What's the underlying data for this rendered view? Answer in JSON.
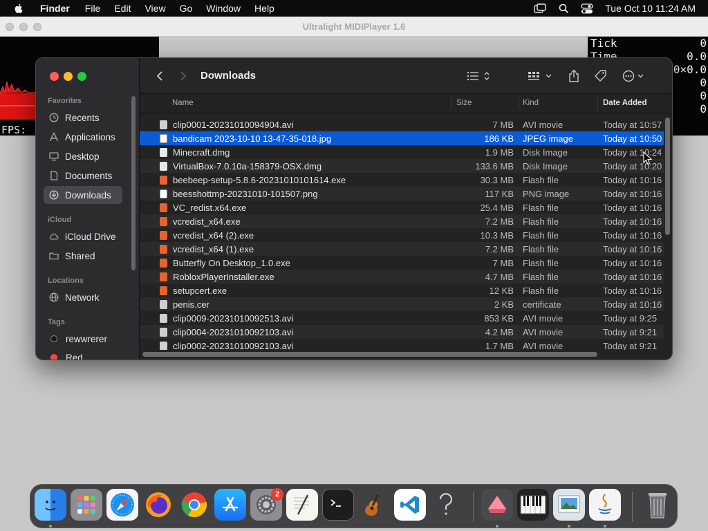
{
  "menubar": {
    "app_name": "Finder",
    "items": [
      "File",
      "Edit",
      "View",
      "Go",
      "Window",
      "Help"
    ],
    "clock": "Tue Oct 10  11:24 AM"
  },
  "background_app": {
    "title": "Ultralight MIDIPlayer 1.6",
    "fps_label": "FPS:",
    "stats": [
      {
        "label": "Tick",
        "value": "0"
      },
      {
        "label": "Time",
        "value": "0.0"
      },
      {
        "label": "",
        "value": "0×0.0"
      },
      {
        "label": "",
        "value": "0"
      },
      {
        "label": "",
        "value": "0"
      },
      {
        "label": "",
        "value": "0"
      }
    ]
  },
  "finder": {
    "folder_title": "Downloads",
    "sidebar": {
      "favorites_label": "Favorites",
      "favorites": [
        {
          "label": "Recents",
          "icon": "clock-icon"
        },
        {
          "label": "Applications",
          "icon": "applications-icon"
        },
        {
          "label": "Desktop",
          "icon": "desktop-icon"
        },
        {
          "label": "Documents",
          "icon": "document-icon"
        },
        {
          "label": "Downloads",
          "icon": "download-icon",
          "selected": true
        }
      ],
      "icloud_label": "iCloud",
      "icloud": [
        {
          "label": "iCloud Drive",
          "icon": "cloud-icon"
        },
        {
          "label": "Shared",
          "icon": "shared-folder-icon"
        }
      ],
      "locations_label": "Locations",
      "locations": [
        {
          "label": "Network",
          "icon": "globe-icon"
        }
      ],
      "tags_label": "Tags",
      "tags": [
        {
          "label": "rewwrerer",
          "color": "#1a1a1a"
        },
        {
          "label": "Red",
          "color": "#ff453a"
        }
      ]
    },
    "columns": {
      "name": "Name",
      "size": "Size",
      "kind": "Kind",
      "date": "Date Added"
    },
    "files": [
      {
        "name": "clip0001-20231010094904.avi",
        "size": "7 MB",
        "kind": "AVI movie",
        "date": "Today at 10:57",
        "icon": "movie"
      },
      {
        "name": "bandicam 2023-10-10 13-47-35-018.jpg",
        "size": "186 KB",
        "kind": "JPEG image",
        "date": "Today at 10:50",
        "icon": "img",
        "selected": true
      },
      {
        "name": "Minecraft.dmg",
        "size": "1.9 MB",
        "kind": "Disk Image",
        "date": "Today at 10:24",
        "icon": "doc"
      },
      {
        "name": "VirtualBox-7.0.10a-158379-OSX.dmg",
        "size": "133.6 MB",
        "kind": "Disk Image",
        "date": "Today at 10:20",
        "icon": "doc"
      },
      {
        "name": "beebeep-setup-5.8.6-20231010101614.exe",
        "size": "30.3 MB",
        "kind": "Flash file",
        "date": "Today at 10:16",
        "icon": "flash"
      },
      {
        "name": "beesshottmp-20231010-101507.png",
        "size": "117 KB",
        "kind": "PNG image",
        "date": "Today at 10:16",
        "icon": "img"
      },
      {
        "name": "VC_redist.x64.exe",
        "size": "25.4 MB",
        "kind": "Flash file",
        "date": "Today at 10:16",
        "icon": "flash"
      },
      {
        "name": "vcredist_x64.exe",
        "size": "7.2 MB",
        "kind": "Flash file",
        "date": "Today at 10:16",
        "icon": "flash"
      },
      {
        "name": "vcredist_x64 (2).exe",
        "size": "10.3 MB",
        "kind": "Flash file",
        "date": "Today at 10:16",
        "icon": "flash"
      },
      {
        "name": "vcredist_x64 (1).exe",
        "size": "7.2 MB",
        "kind": "Flash file",
        "date": "Today at 10:16",
        "icon": "flash"
      },
      {
        "name": "Butterfly On Desktop_1.0.exe",
        "size": "7 MB",
        "kind": "Flash file",
        "date": "Today at 10:16",
        "icon": "flash"
      },
      {
        "name": "RobloxPlayerInstaller.exe",
        "size": "4.7 MB",
        "kind": "Flash file",
        "date": "Today at 10:16",
        "icon": "flash"
      },
      {
        "name": "setupcert.exe",
        "size": "12 KB",
        "kind": "Flash file",
        "date": "Today at 10:16",
        "icon": "flash"
      },
      {
        "name": "penis.cer",
        "size": "2 KB",
        "kind": "certificate",
        "date": "Today at 10:16",
        "icon": "movie"
      },
      {
        "name": "clip0009-20231010092513.avi",
        "size": "853 KB",
        "kind": "AVI movie",
        "date": "Today at 9:25",
        "icon": "movie"
      },
      {
        "name": "clip0004-20231010092103.avi",
        "size": "4.2 MB",
        "kind": "AVI movie",
        "date": "Today at 9:21",
        "icon": "movie"
      },
      {
        "name": "clip0002-20231010092103.avi",
        "size": "1.7 MB",
        "kind": "AVI movie",
        "date": "Today at 9:21",
        "icon": "movie"
      }
    ]
  },
  "dock": {
    "items": [
      {
        "name": "finder-dock-icon",
        "bg": "#2f8ff0",
        "running": true
      },
      {
        "name": "launchpad-dock-icon",
        "bg": "#8e8e93",
        "running": false
      },
      {
        "name": "safari-dock-icon",
        "bg": "#1b8ff2",
        "running": false
      },
      {
        "name": "firefox-dock-icon",
        "bg": "#ff7a1c",
        "running": false
      },
      {
        "name": "chrome-dock-icon",
        "bg": "#f2f2f2",
        "running": false
      },
      {
        "name": "app-store-dock-icon",
        "bg": "#1d7cf2",
        "running": false
      },
      {
        "name": "system-settings-dock-icon",
        "bg": "#9a9a9e",
        "running": false
      },
      {
        "name": "textedit-dock-icon",
        "bg": "#f4f4f0",
        "running": false
      },
      {
        "name": "terminal-dock-icon",
        "bg": "#1c1c1c",
        "running": false
      },
      {
        "name": "garageband-dock-icon",
        "bg": "#3a2a1a",
        "running": false
      },
      {
        "name": "vscode-dock-icon",
        "bg": "#ffffff",
        "running": false
      },
      {
        "name": "help-question-dock-icon",
        "bg": "transparent",
        "running": false
      },
      {
        "name": "pink-app-dock-icon",
        "bg": "#6a6a6c",
        "running": true
      },
      {
        "name": "piano-dock-icon",
        "bg": "#222222",
        "running": false
      },
      {
        "name": "preview-dock-icon",
        "bg": "#cfd8e0",
        "running": true
      },
      {
        "name": "java-dock-icon",
        "bg": "#f2f2f2",
        "running": true
      },
      {
        "name": "trash-dock-icon",
        "bg": "transparent",
        "running": false
      }
    ],
    "settings_badge": "2"
  }
}
